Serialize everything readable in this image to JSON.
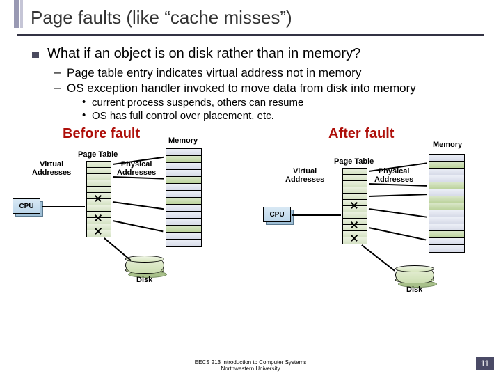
{
  "title": "Page faults (like “cache misses”)",
  "bullets": {
    "l1": "What if an object is on disk rather than in memory?",
    "l2a": "Page table entry indicates virtual address not in memory",
    "l2b": "OS exception handler invoked to move data from disk into memory",
    "l3a": "current process suspends, others can resume",
    "l3b": "OS has full control over placement, etc."
  },
  "diagram": {
    "before_title": "Before fault",
    "after_title": "After fault",
    "memory_label": "Memory",
    "page_table_label": "Page Table",
    "virtual_addresses_label": "Virtual\nAddresses",
    "physical_addresses_label": "Physical\nAddresses",
    "cpu_label": "CPU",
    "disk_label": "Disk"
  },
  "footer": {
    "line1": "EECS 213 Introduction to Computer Systems",
    "line2": "Northwestern University"
  },
  "page_number": "11"
}
